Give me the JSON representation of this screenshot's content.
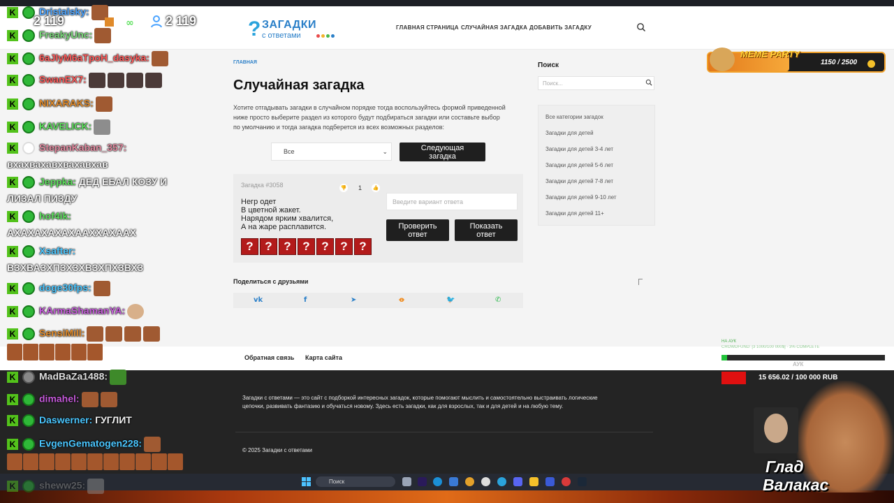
{
  "header": {
    "logo_mark": "?",
    "logo_title": "ЗАГАДКИ",
    "logo_subtitle": "с ответами",
    "nav": [
      "ГЛАВНАЯ СТРАНИЦА",
      "СЛУЧАЙНАЯ ЗАГАДКА",
      "ДОБАВИТЬ ЗАГАДКУ"
    ],
    "icons": {
      "search": "search-icon"
    }
  },
  "content": {
    "breadcrumb": "ГЛАВНАЯ",
    "title": "Случайная загадка",
    "intro_lines": [
      "Хотите отгадывать загадки в случайном порядке тогда воспользуйтесь формой приведенной",
      "ниже просто выберите раздел из которого будут подбираться загадки или составьте выбор",
      "по умолчанию и тогда загадка подберется из всех возможных разделов:"
    ],
    "category_select": "Все",
    "next_button_lines": [
      "Следующая",
      "загадка"
    ],
    "riddle": {
      "number": "Загадка #3058",
      "votes": "1",
      "lines": [
        "Негр одет",
        "В цветной жакет.",
        "Нарядом ярким хвалится,",
        "А на жаре расплавится."
      ],
      "hidden_letters": [
        "?",
        "?",
        "?",
        "?",
        "?",
        "?",
        "?"
      ],
      "answer_placeholder": "Введите вариант ответа",
      "check_button_lines": [
        "Проверить",
        "ответ"
      ],
      "show_button_lines": [
        "Показать",
        "ответ"
      ]
    },
    "share_title": "Поделиться с друзьями",
    "share_icons": [
      "vk-icon",
      "facebook-icon",
      "telegram-icon",
      "odnoklassniki-icon",
      "twitter-icon",
      "whatsapp-icon"
    ],
    "share_glyphs": [
      "vk",
      "f",
      "➤",
      "ꝋ",
      "🐦",
      "✆"
    ]
  },
  "sidebar": {
    "search_title": "Поиск",
    "search_placeholder": "Поиск...",
    "categories": [
      "Все категории загадок",
      "Загадки для детей",
      "Загадки для детей 3-4 лет",
      "Загадки для детей 5-6 лет",
      "Загадки для детей 7-8 лет",
      "Загадки для детей 9-10 лет",
      "Загадки для детей 11+"
    ]
  },
  "footer": {
    "links": [
      "Обратная связь",
      "Карта сайта"
    ],
    "description_lines": [
      "Загадки с ответами — это сайт с подборкой интересных загадок, которые помогают мыслить и самостоятельно выстраивать логические",
      "цепочки, развивать фантазию и обучаться новому. Здесь есть загадки, как для взрослых, так и для детей и на любую тему."
    ],
    "copyright": "© 2025 Загадки с ответами"
  },
  "taskbar": {
    "search_label": "Поиск"
  },
  "chat": {
    "messages": [
      {
        "user": "Dristalsky:",
        "color": "#4aa3ff",
        "text": ""
      },
      {
        "user": "FreakyUnc:",
        "color": "#7ad97a",
        "text": ""
      },
      {
        "user": "6aJIyM6aTpoH_dasyka:",
        "color": "#ff5a5a",
        "text": ""
      },
      {
        "user": "SwanEX7:",
        "color": "#ff5a5a",
        "text": ""
      },
      {
        "user": "NIXARAKS:",
        "color": "#e08a2a",
        "text": ""
      },
      {
        "user": "KAVELICK:",
        "color": "#5de05d",
        "text": ""
      },
      {
        "user": "StepanKaban_357:",
        "color": "#e48aa0",
        "text": ""
      },
      {
        "user": "Jeppka:",
        "color": "#5de05d",
        "text": "ДЕД ЕБАЛ КОЗУ И"
      },
      {
        "user": "hof4ik:",
        "color": "#5de05d",
        "text": ""
      },
      {
        "user": "Xsafter:",
        "color": "#4ac6ff",
        "text": ""
      },
      {
        "user": "doge30fps:",
        "color": "#4ac6ff",
        "text": ""
      },
      {
        "user": "KArmaShamanYA:",
        "color": "#c45ad9",
        "text": ""
      },
      {
        "user": "SensiMill:",
        "color": "#e08a2a",
        "text": ""
      },
      {
        "user": "MadBaZa1488:",
        "color": "#e0e0e0",
        "text": ""
      },
      {
        "user": "dimahel:",
        "color": "#c45ad9",
        "text": ""
      },
      {
        "user": "Daswerner:",
        "color": "#4ac6ff",
        "text": "ГУГЛИТ"
      },
      {
        "user": "EvgenGematogen228:",
        "color": "#4ac6ff",
        "text": ""
      },
      {
        "user": "sheww25:",
        "color": "#8a8a8a",
        "text": ""
      }
    ],
    "wrapped": [
      "вхахвахавхвахавхав",
      "ЛИЗАЛ ПИЗДУ",
      "АХАХАХАХАХААХХАХААХ",
      "ВЗХВАЗХПЗХЗХВЗХПХЗВХЗ"
    ]
  },
  "stream": {
    "viewers_left": "2 119",
    "viewers_right": "2 119",
    "meme_title": "MEME PARTY",
    "meme_count": "1150 / 2500",
    "meme_progress": 0.46,
    "donation_small1": "НА АУК",
    "donation_small2": "CROWDFUND: [3 1000/100 000$] · 3% COMPLETE",
    "donation_tag": "АУК",
    "donation_amount": "15 656.02 / 100 000 RUB",
    "channel_name_lines": [
      "Глад",
      "Валакас"
    ]
  }
}
